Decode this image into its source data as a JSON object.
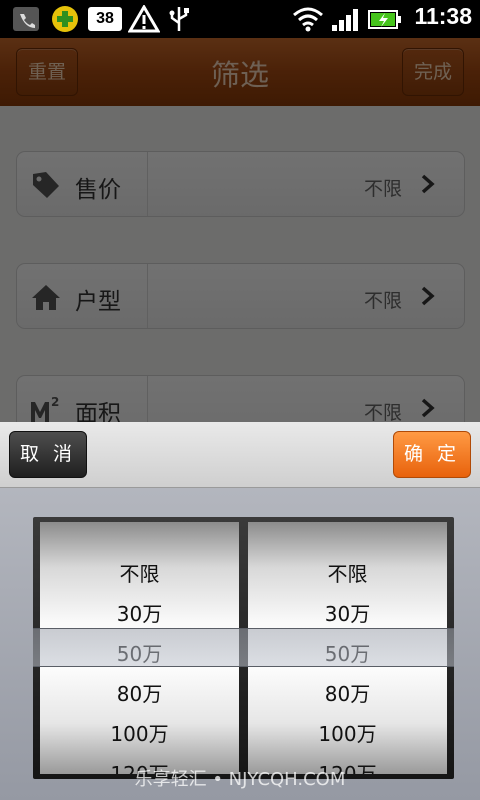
{
  "status_bar": {
    "time": "11:38",
    "notification_badge": "38",
    "icons": [
      "phone-icon",
      "plus-badge-icon",
      "mail-icon",
      "warning-icon",
      "usb-icon",
      "wifi-icon",
      "signal-icon",
      "battery-icon"
    ]
  },
  "header": {
    "title": "筛选",
    "reset_label": "重置",
    "done_label": "完成"
  },
  "filters": [
    {
      "label": "售价",
      "value": "不限",
      "icon": "price-tag-icon"
    },
    {
      "label": "户型",
      "value": "不限",
      "icon": "house-icon"
    },
    {
      "label": "面积",
      "value": "不限",
      "icon": "area-m2-icon"
    }
  ],
  "picker": {
    "cancel_label": "取 消",
    "confirm_label": "确 定",
    "left_options": [
      "不限",
      "30万",
      "50万",
      "80万",
      "100万",
      "120万"
    ],
    "right_options": [
      "不限",
      "30万",
      "50万",
      "80万",
      "100万",
      "120万"
    ],
    "left_selected": "50万",
    "right_selected": "50万"
  },
  "watermark": "乐享轻汇 • NJYCQH.COM",
  "colors": {
    "header_orange": "#a54a12",
    "confirm_orange": "#f07a22",
    "cancel_dark": "#2e2e2e"
  }
}
